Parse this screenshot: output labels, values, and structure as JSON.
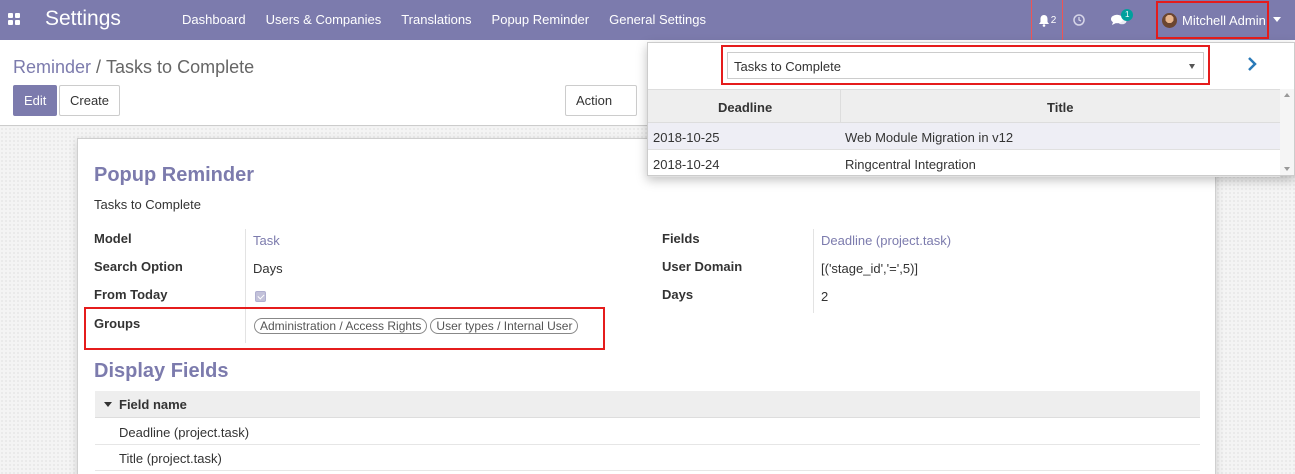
{
  "app": {
    "brand": "Settings"
  },
  "menu": [
    "Dashboard",
    "Users & Companies",
    "Translations",
    "Popup Reminder",
    "General Settings"
  ],
  "systray": {
    "bell_count": "2",
    "chat_count": "1",
    "user_name": "Mitchell Admin"
  },
  "breadcrumb": {
    "parent": "Reminder",
    "separator": "/",
    "current": "Tasks to Complete"
  },
  "buttons": {
    "edit": "Edit",
    "create": "Create",
    "action": "Action"
  },
  "form": {
    "title": "Popup Reminder",
    "subtitle": "Tasks to Complete",
    "fields": {
      "model": {
        "label": "Model",
        "value": "Task"
      },
      "search_option": {
        "label": "Search Option",
        "value": "Days"
      },
      "from_today": {
        "label": "From Today",
        "checked": true
      },
      "groups": {
        "label": "Groups",
        "tags": [
          "Administration / Access Rights",
          "User types / Internal User"
        ]
      },
      "fields": {
        "label": "Fields",
        "value": "Deadline (project.task)"
      },
      "user_domain": {
        "label": "User Domain",
        "value": "[('stage_id','=',5)]"
      },
      "days": {
        "label": "Days",
        "value": "2"
      }
    },
    "display_fields": {
      "title": "Display Fields",
      "column": "Field name",
      "rows": [
        "Deadline (project.task)",
        "Title (project.task)"
      ]
    }
  },
  "popup": {
    "selected": "Tasks to Complete",
    "columns": [
      "Deadline",
      "Title"
    ],
    "rows": [
      {
        "deadline": "2018-10-25",
        "title": "Web Module Migration in v12"
      },
      {
        "deadline": "2018-10-24",
        "title": "Ringcentral Integration"
      }
    ]
  },
  "colors": {
    "primary": "#7c7bad",
    "highlight": "#e51c1c",
    "chat_badge": "#00a09d"
  }
}
